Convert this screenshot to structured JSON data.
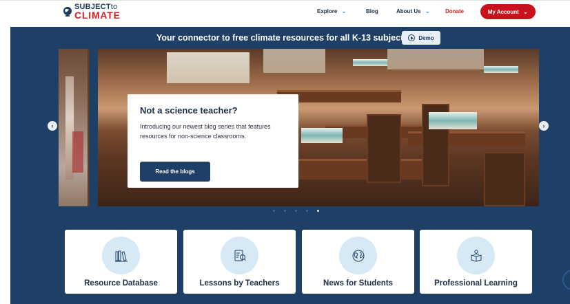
{
  "brand": {
    "line1": "SUBJECT",
    "line1_suffix": "to",
    "line2": "CLIMATE",
    "navy": "#1c3b5e",
    "red": "#d81f26"
  },
  "nav": {
    "explore": "Explore",
    "blog": "Blog",
    "about": "About Us",
    "donate": "Donate",
    "account": "My Account"
  },
  "hero": {
    "tagline": "Your connector to free climate resources for all K-13 subjects.",
    "demo_label": "Demo"
  },
  "carousel": {
    "title": "Not a science teacher?",
    "body": "Introducing our newest blog series that features resources for non-science classrooms.",
    "cta": "Read the blogs",
    "slide_count": 5,
    "active_index": 4
  },
  "categories": [
    {
      "label": "Resource Database",
      "icon": "library-books-icon"
    },
    {
      "label": "Lessons by Teachers",
      "icon": "lesson-plan-icon"
    },
    {
      "label": "News for Students",
      "icon": "globe-icon"
    },
    {
      "label": "Professional Learning",
      "icon": "reading-teacher-icon"
    }
  ],
  "colors": {
    "band": "#1e3f66",
    "accent_red": "#c8121c",
    "icon_circle": "#d6e9f5"
  }
}
